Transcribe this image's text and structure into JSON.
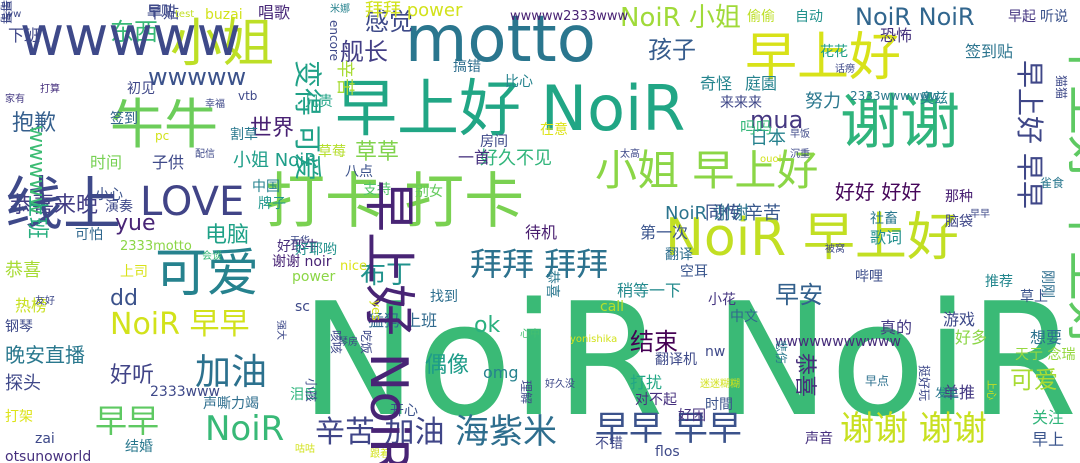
{
  "words": [
    {
      "text": "NoiR NoiR",
      "color": "#3aba76",
      "vertical": false
    },
    {
      "text": "motto",
      "color": "#2a768e",
      "vertical": false
    },
    {
      "text": "早上好 NoiR",
      "color": "#21a685",
      "vertical": false
    },
    {
      "text": "打卡 打卡",
      "color": "#7ad151",
      "vertical": false
    },
    {
      "text": "谢谢",
      "color": "#2fb47c",
      "vertical": false
    },
    {
      "text": "牛牛",
      "color": "#6ccd5a",
      "vertical": false
    },
    {
      "text": "小姐",
      "color": "#bddf26",
      "vertical": false
    },
    {
      "text": "早上好",
      "color": "#d8e219",
      "vertical": false
    },
    {
      "text": "NoiR 早上好",
      "color": "#c2df23",
      "vertical": false
    },
    {
      "text": "可爱",
      "color": "#26828e",
      "vertical": false
    },
    {
      "text": "小姐 早上好",
      "color": "#8bd646",
      "vertical": false
    },
    {
      "text": "LOVE",
      "color": "#414487",
      "vertical": false
    },
    {
      "text": "拜拜 拜拜",
      "color": "#2c728e",
      "vertical": false
    },
    {
      "text": "海紫米",
      "color": "#2e6e8e",
      "vertical": false
    },
    {
      "text": "谢谢 谢谢",
      "color": "#c8e020",
      "vertical": false
    },
    {
      "text": "早早 早早",
      "color": "#3b528b",
      "vertical": false
    },
    {
      "text": "辛苦 加油",
      "color": "#404688",
      "vertical": false
    },
    {
      "text": "NoiR 早早",
      "color": "#d2e21b",
      "vertical": false
    },
    {
      "text": "NoiR",
      "color": "#38b977",
      "vertical": false
    },
    {
      "text": "早早",
      "color": "#5ec962",
      "vertical": false
    },
    {
      "text": "加油",
      "color": "#2c718e",
      "vertical": false
    },
    {
      "text": "NoiR 小姐",
      "color": "#a0da39",
      "vertical": false
    },
    {
      "text": "NoiR NoiR",
      "color": "#31668e",
      "vertical": false
    },
    {
      "text": "感觉",
      "color": "#3e4a89",
      "vertical": false
    },
    {
      "text": "孩子",
      "color": "#365c8d",
      "vertical": false
    },
    {
      "text": "舰长",
      "color": "#433e85",
      "vertical": false
    },
    {
      "text": "东西",
      "color": "#38b977",
      "vertical": false
    },
    {
      "text": "wwwww",
      "color": "#3b528b",
      "vertical": false
    },
    {
      "text": "mua",
      "color": "#453781",
      "vertical": false
    },
    {
      "text": "抱歉",
      "color": "#355f8d",
      "vertical": false
    },
    {
      "text": "世界",
      "color": "#482173",
      "vertical": false
    },
    {
      "text": "草草",
      "color": "#81d34d",
      "vertical": false
    },
    {
      "text": "好久不见",
      "color": "#31b57b",
      "vertical": false
    },
    {
      "text": "小姐 NoiR",
      "color": "#1f9e89",
      "vertical": false
    },
    {
      "text": "好好 好好",
      "color": "#450559",
      "vertical": false
    },
    {
      "text": "恭喜来晚",
      "color": "#433d84",
      "vertical": false
    },
    {
      "text": "yue",
      "color": "#482576",
      "vertical": false
    },
    {
      "text": "电脑",
      "color": "#1fa187",
      "vertical": false
    },
    {
      "text": "布丁",
      "color": "#20928c",
      "vertical": false
    },
    {
      "text": "早安",
      "color": "#34618d",
      "vertical": false
    },
    {
      "text": "dd",
      "color": "#3b528b",
      "vertical": false
    },
    {
      "text": "ok",
      "color": "#2ab07f",
      "vertical": false
    },
    {
      "text": "结束",
      "color": "#440154",
      "vertical": false
    },
    {
      "text": "晚安直播",
      "color": "#2a788e",
      "vertical": false
    },
    {
      "text": "好听",
      "color": "#414487",
      "vertical": false
    },
    {
      "text": "可爱",
      "color": "#a8db34",
      "vertical": false
    },
    {
      "text": "偶像",
      "color": "#1e9c89",
      "vertical": false
    },
    {
      "text": "探头",
      "color": "#3f4889",
      "vertical": false
    },
    {
      "text": "日本",
      "color": "#26828e",
      "vertical": false
    },
    {
      "text": "NoiR 谢谢",
      "color": "#2b748e",
      "vertical": false
    },
    {
      "text": "同传",
      "color": "#3b528b",
      "vertical": false
    },
    {
      "text": "辛苦",
      "color": "#38588c",
      "vertical": false
    },
    {
      "text": "拜拜 power",
      "color": "#d2e21b",
      "vertical": false
    },
    {
      "text": "早贴",
      "color": "#3e4989",
      "vertical": false
    },
    {
      "text": "唱歌",
      "color": "#482878",
      "vertical": false
    },
    {
      "text": "一首",
      "color": "#46307e",
      "vertical": false
    },
    {
      "text": "打扰",
      "color": "#22a785",
      "vertical": false
    },
    {
      "text": "关注",
      "color": "#31b57b",
      "vertical": false
    },
    {
      "text": "早上",
      "color": "#3a548c",
      "vertical": false
    },
    {
      "text": "声音",
      "color": "#46307e",
      "vertical": false
    },
    {
      "text": "真的",
      "color": "#443a83",
      "vertical": false
    },
    {
      "text": "游戏",
      "color": "#3e4a89",
      "vertical": false
    },
    {
      "text": "想要",
      "color": "#2c728e",
      "vertical": false
    },
    {
      "text": "好多",
      "color": "#8bd646",
      "vertical": false
    },
    {
      "text": "天亍 念瑞",
      "color": "#95d840",
      "vertical": false
    },
    {
      "text": "单推",
      "color": "#443983",
      "vertical": false
    },
    {
      "text": "努力",
      "color": "#2a778e",
      "vertical": false
    },
    {
      "text": "奇怪",
      "color": "#25848e",
      "vertical": false
    },
    {
      "text": "庭園",
      "color": "#26828e",
      "vertical": false
    },
    {
      "text": "吗吗",
      "color": "#35b779",
      "vertical": false
    },
    {
      "text": "来来来",
      "color": "#3f4788",
      "vertical": false
    },
    {
      "text": "偷偷",
      "color": "#bddf26",
      "vertical": false
    },
    {
      "text": "自动",
      "color": "#21918c",
      "vertical": false
    },
    {
      "text": "恐怖",
      "color": "#46337f",
      "vertical": false
    },
    {
      "text": "签到贴",
      "color": "#2b748e",
      "vertical": false
    },
    {
      "text": "听说",
      "color": "#3b528b",
      "vertical": false
    },
    {
      "text": "早起",
      "color": "#453581",
      "vertical": false
    },
    {
      "text": "花花",
      "color": "#1f9e89",
      "vertical": false
    },
    {
      "text": "奥兹",
      "color": "#26828e",
      "vertical": false
    },
    {
      "text": "雀食",
      "color": "#2a778e",
      "vertical": false
    },
    {
      "text": "那种",
      "color": "#482173",
      "vertical": false
    },
    {
      "text": "推荐",
      "color": "#24878e",
      "vertical": false
    },
    {
      "text": "草上",
      "color": "#3b528b",
      "vertical": false
    },
    {
      "text": "哔哩",
      "color": "#3d4e8a",
      "vertical": false
    },
    {
      "text": "歌词",
      "color": "#218f8d",
      "vertical": false
    },
    {
      "text": "脑袋",
      "color": "#3f4788",
      "vertical": false
    },
    {
      "text": "社畜",
      "color": "#2a788e",
      "vertical": false
    },
    {
      "text": "第一次",
      "color": "#3a548c",
      "vertical": false
    },
    {
      "text": "待机",
      "color": "#481d6f",
      "vertical": false
    },
    {
      "text": "翻译",
      "color": "#2e6e8e",
      "vertical": false
    },
    {
      "text": "空耳",
      "color": "#39558c",
      "vertical": false
    },
    {
      "text": "稍等一下",
      "color": "#238a8d",
      "vertical": false
    },
    {
      "text": "小花",
      "color": "#453581",
      "vertical": false
    },
    {
      "text": "中文",
      "color": "#31688e",
      "vertical": false
    },
    {
      "text": "翻译机",
      "color": "#3e4a89",
      "vertical": false
    },
    {
      "text": "对不起",
      "color": "#46307e",
      "vertical": false
    },
    {
      "text": "时間",
      "color": "#3b528b",
      "vertical": false
    },
    {
      "text": "好困",
      "color": "#46327e",
      "vertical": false
    },
    {
      "text": "不错",
      "color": "#3f4889",
      "vertical": false
    },
    {
      "text": "早点",
      "color": "#2d708e",
      "vertical": false
    },
    {
      "text": "发生",
      "color": "#2a778e",
      "vertical": false
    },
    {
      "text": "猛犸 上班",
      "color": "#306a8e",
      "vertical": false
    },
    {
      "text": "找到",
      "color": "#2e6f8e",
      "vertical": false
    },
    {
      "text": "心中",
      "color": "#44bf70",
      "vertical": false
    },
    {
      "text": "omg",
      "color": "#26828e",
      "vertical": false
    },
    {
      "text": "开心",
      "color": "#3b528b",
      "vertical": false
    },
    {
      "text": "声嘶力竭",
      "color": "#2e6e8e",
      "vertical": false
    },
    {
      "text": "泪目",
      "color": "#2fb47c",
      "vertical": false
    },
    {
      "text": "nice",
      "color": "#dde318",
      "vertical": false
    },
    {
      "text": "谢谢 noir",
      "color": "#482475",
      "vertical": false
    },
    {
      "text": "好耶牛",
      "color": "#472d7b",
      "vertical": false
    },
    {
      "text": "好耶哟",
      "color": "#21918c",
      "vertical": false
    },
    {
      "text": "power",
      "color": "#8bd646",
      "vertical": false
    },
    {
      "text": "支持",
      "color": "#52c569",
      "vertical": false
    },
    {
      "text": "别女",
      "color": "#65cb5e",
      "vertical": false
    },
    {
      "text": "八点",
      "color": "#3b528b",
      "vertical": false
    },
    {
      "text": "房间",
      "color": "#3e4989",
      "vertical": false
    },
    {
      "text": "在意",
      "color": "#dde318",
      "vertical": false
    },
    {
      "text": "比心",
      "color": "#25838e",
      "vertical": false
    },
    {
      "text": "搞错",
      "color": "#2e6e8e",
      "vertical": false
    },
    {
      "text": "兄贵",
      "color": "#20a386",
      "vertical": false
    },
    {
      "text": "草莓",
      "color": "#b5de2b",
      "vertical": false
    },
    {
      "text": "中国",
      "color": "#26828e",
      "vertical": false
    },
    {
      "text": "牌子",
      "color": "#1f958b",
      "vertical": false
    },
    {
      "text": "时间",
      "color": "#77d153",
      "vertical": false
    },
    {
      "text": "子供",
      "color": "#3e4989",
      "vertical": false
    },
    {
      "text": "初见",
      "color": "#3f4788",
      "vertical": false
    },
    {
      "text": "签到",
      "color": "#33638d",
      "vertical": false
    },
    {
      "text": "下班",
      "color": "#3f4788",
      "vertical": false
    },
    {
      "text": "早贴",
      "color": "#3e4989",
      "vertical": false
    },
    {
      "text": "割草",
      "color": "#2a788e",
      "vertical": false
    },
    {
      "text": "幸福",
      "color": "#3e4989",
      "vertical": false
    },
    {
      "text": "小心",
      "color": "#3b528b",
      "vertical": false
    },
    {
      "text": "演奏",
      "color": "#3e4989",
      "vertical": false
    },
    {
      "text": "可怕",
      "color": "#31688e",
      "vertical": false
    },
    {
      "text": "恭喜",
      "color": "#a8db34",
      "vertical": false
    },
    {
      "text": "上司",
      "color": "#d8e219",
      "vertical": false
    },
    {
      "text": "热榜",
      "color": "#c8e020",
      "vertical": false
    },
    {
      "text": "钢琴",
      "color": "#3e4a89",
      "vertical": false
    },
    {
      "text": "打架",
      "color": "#dde318",
      "vertical": false
    },
    {
      "text": "zai",
      "color": "#3e4989",
      "vertical": false
    },
    {
      "text": "otsunoworld",
      "color": "#46307e",
      "vertical": false
    },
    {
      "text": "结婚",
      "color": "#2a788e",
      "vertical": false
    },
    {
      "text": "2333www",
      "color": "#3e4989",
      "vertical": false
    },
    {
      "text": "2333motto",
      "color": "#8bd646",
      "vertical": false
    },
    {
      "text": "wwwww2333www",
      "color": "#482173",
      "vertical": false
    },
    {
      "text": "2333wwwwww",
      "color": "#2a788e",
      "vertical": false
    },
    {
      "text": "wwwwwwwwwww",
      "color": "#472d7b",
      "vertical": false
    },
    {
      "text": "flos",
      "color": "#3e4989",
      "vertical": false
    },
    {
      "text": "vtb",
      "color": "#3e4989",
      "vertical": false
    },
    {
      "text": "buzai",
      "color": "#d2e21b",
      "vertical": false
    },
    {
      "text": "sc",
      "color": "#3e4989",
      "vertical": false
    },
    {
      "text": "call",
      "color": "#b5de2b",
      "vertical": false
    },
    {
      "text": "nw",
      "color": "#3e4989",
      "vertical": false
    },
    {
      "text": "pc",
      "color": "#d2e21b",
      "vertical": false
    },
    {
      "text": "ww",
      "color": "#3e4989",
      "vertical": false
    },
    {
      "text": "test",
      "color": "#c2df23",
      "vertical": false
    },
    {
      "text": "米娜",
      "color": "#26828e",
      "vertical": false
    },
    {
      "text": "家有",
      "color": "#443a83",
      "vertical": false
    },
    {
      "text": "打算",
      "color": "#46307e",
      "vertical": false
    },
    {
      "text": "配信",
      "color": "#3e4989",
      "vertical": false
    },
    {
      "text": "天华",
      "color": "#3e4989",
      "vertical": false
    },
    {
      "text": "会谈",
      "color": "#38b977",
      "vertical": false
    },
    {
      "text": "太高",
      "color": "#3e4989",
      "vertical": false
    },
    {
      "text": "沉重",
      "color": "#3e4989",
      "vertical": false
    },
    {
      "text": "早饭",
      "color": "#3e4989",
      "vertical": false
    },
    {
      "text": "话痨",
      "color": "#3e4989",
      "vertical": false
    },
    {
      "text": "被窝",
      "color": "#3e4989",
      "vertical": false
    },
    {
      "text": "早早",
      "color": "#3e4989",
      "vertical": false
    },
    {
      "text": "友好",
      "color": "#3e4989",
      "vertical": false
    },
    {
      "text": "yonishika",
      "color": "#d2e21b",
      "vertical": false
    },
    {
      "text": "ouol",
      "color": "#d2e21b",
      "vertical": false
    },
    {
      "text": "迷迷糊糊",
      "color": "#d2e21b",
      "vertical": false
    },
    {
      "text": "好久没",
      "color": "#3e4989",
      "vertical": false
    },
    {
      "text": "琴房",
      "color": "#3e4989",
      "vertical": false
    },
    {
      "text": "咕咕",
      "color": "#d2e21b",
      "vertical": false
    },
    {
      "text": "跟着",
      "color": "#d2e21b",
      "vertical": false
    },
    {
      "text": "wwwww",
      "color": "#3e4989",
      "vertical": false
    },
    {
      "text": "线上",
      "color": "#3e4989",
      "vertical": false
    },
    {
      "text": "早上好 早上好",
      "color": "#5ec962",
      "vertical": true
    },
    {
      "text": "早上好 早早",
      "color": "#3f4788",
      "vertical": true
    },
    {
      "text": "早上好 NoiR",
      "color": "#482475",
      "vertical": true
    },
    {
      "text": "变得 可爱",
      "color": "#1fa187",
      "vertical": true
    },
    {
      "text": "辛苦",
      "color": "#a8db34",
      "vertical": true
    },
    {
      "text": "wwwww",
      "color": "#3dbc74",
      "vertical": true
    },
    {
      "text": "上班",
      "color": "#29af7f",
      "vertical": true
    },
    {
      "text": "恭喜",
      "color": "#472d7b",
      "vertical": true
    },
    {
      "text": "恭喜",
      "color": "#2a778e",
      "vertical": true
    },
    {
      "text": "刚刚",
      "color": "#2e6e8e",
      "vertical": true
    },
    {
      "text": "悲伤",
      "color": "#2a788e",
      "vertical": true
    },
    {
      "text": "小孩",
      "color": "#3e4989",
      "vertical": true
    },
    {
      "text": "理解",
      "color": "#3e4989",
      "vertical": true
    },
    {
      "text": "挺好玩",
      "color": "#3e4989",
      "vertical": true
    },
    {
      "text": "encore",
      "color": "#3e4989",
      "vertical": true
    },
    {
      "text": "yes",
      "color": "#d2e21b",
      "vertical": true
    },
    {
      "text": "咳咳",
      "color": "#3e4989",
      "vertical": true
    },
    {
      "text": "吃饭",
      "color": "#3e4989",
      "vertical": true
    },
    {
      "text": "猫猫",
      "color": "#3e4989",
      "vertical": true
    },
    {
      "text": "上心",
      "color": "#d2e21b",
      "vertical": true
    },
    {
      "text": "强大",
      "color": "#3e4989",
      "vertical": true
    },
    {
      "text": "早早",
      "color": "#3e4989",
      "vertical": true
    },
    {
      "text": "哥哥",
      "color": "#3e4989",
      "vertical": true
    }
  ]
}
